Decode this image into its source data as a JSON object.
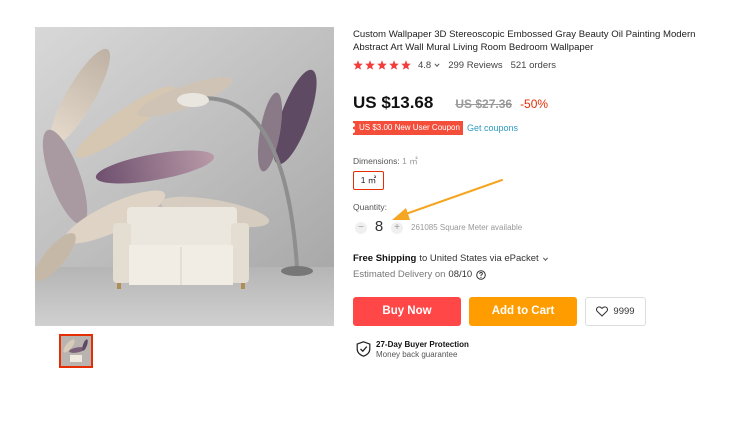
{
  "product": {
    "title": "Custom Wallpaper 3D Stereoscopic Embossed Gray Beauty Oil Painting Modern Abstract Art Wall Mural Living Room Bedroom Wallpaper",
    "rating": "4.8",
    "rating_stars": 5,
    "reviews": "299 Reviews",
    "orders": "521 orders"
  },
  "pricing": {
    "price": "US $13.68",
    "original_price": "US $27.36",
    "discount": "-50%",
    "coupon": "US $3.00 New User Coupon",
    "get_coupons": "Get coupons"
  },
  "dimensions": {
    "label": "Dimensions:",
    "value": "1 ㎡",
    "option": "1 ㎡"
  },
  "quantity": {
    "label": "Quantity:",
    "minus": "−",
    "plus": "+",
    "value": "8",
    "available": "261085 Square Meter available"
  },
  "shipping": {
    "free_label": "Free Shipping",
    "rest": "to United States via ePacket",
    "delivery_label": "Estimated Delivery on",
    "delivery_date": "08/10"
  },
  "actions": {
    "buy_now": "Buy Now",
    "add_to_cart": "Add to Cart",
    "wishlist_count": "9999"
  },
  "protection": {
    "title": "27-Day Buyer Protection",
    "subtitle": "Money back guarantee"
  },
  "icons": {
    "star": "star-icon",
    "chevron": "chevron-down-icon",
    "help": "help-icon",
    "heart": "heart-icon",
    "shield": "shield-check-icon",
    "arrow": "annotation-arrow-icon"
  },
  "colors": {
    "accent_red": "#e62e04",
    "buy_now": "#ff4747",
    "add_to_cart": "#ff9c00",
    "link_blue": "#2e9cc3",
    "annotation_arrow": "#f5a623"
  }
}
